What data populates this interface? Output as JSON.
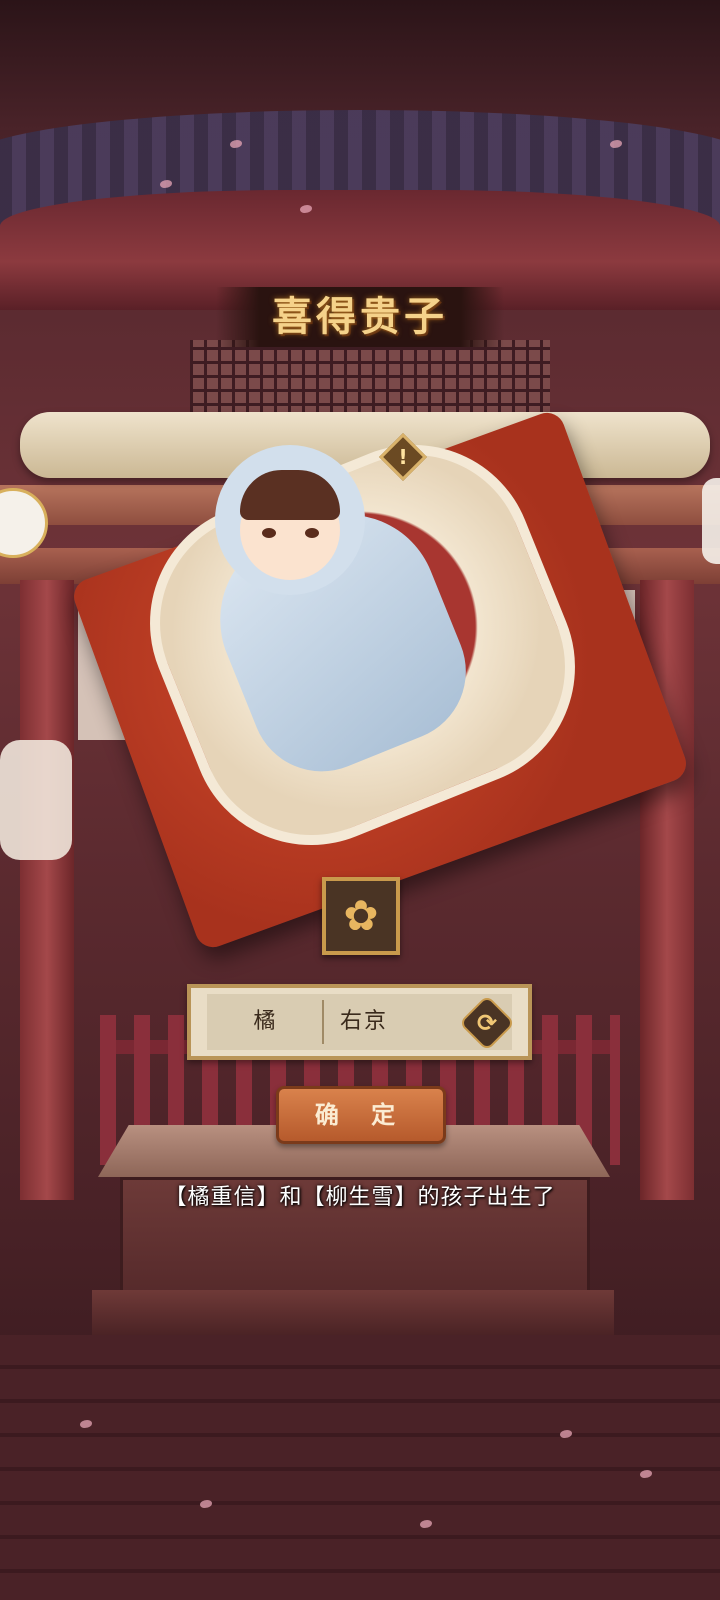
{
  "title": "喜得贵子",
  "crest": {
    "icon": "family-crest-icon"
  },
  "name": {
    "surname": "橘",
    "given_name": "右京",
    "refresh_icon": "refresh-icon"
  },
  "confirm_label": "确 定",
  "message": "【橘重信】和【柳生雪】的孩子出生了",
  "warning_icon": "exclamation-icon",
  "colors": {
    "title_gold": "#f5d28a",
    "panel_bg": "#e9ddc6",
    "panel_border": "#b99457",
    "button_orange": "#d9824c",
    "shrine_red": "#8c3a3f"
  }
}
